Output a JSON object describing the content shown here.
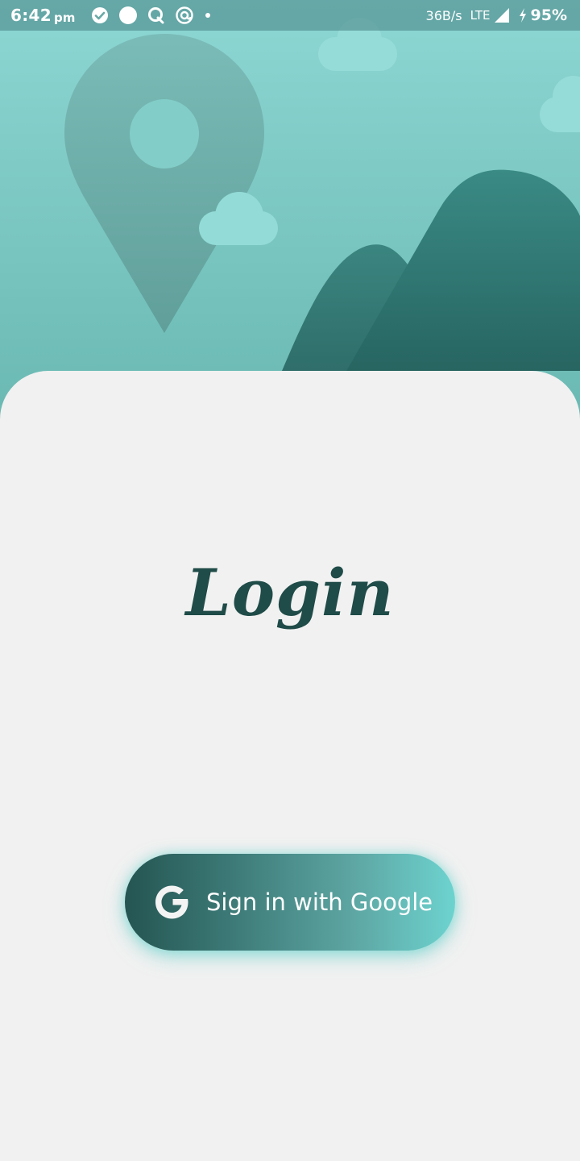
{
  "status_bar": {
    "time": "6:42",
    "ampm": "pm",
    "notification_icons": [
      "check-circle-icon",
      "circle-icon",
      "q-app-icon",
      "at-sign-icon",
      "dot-icon"
    ],
    "net_speed": "36B/s",
    "network": "LTE",
    "battery": "95%"
  },
  "login": {
    "title": "Login",
    "google_button_label": "Sign in with Google"
  },
  "colors": {
    "hero_sky": "#8dd7d4",
    "mountain_dark": "#2b6f6a",
    "title": "#1f4b48",
    "button_start": "#245552",
    "button_end": "#6dd3cf",
    "card_background": "#f1f1f1"
  }
}
